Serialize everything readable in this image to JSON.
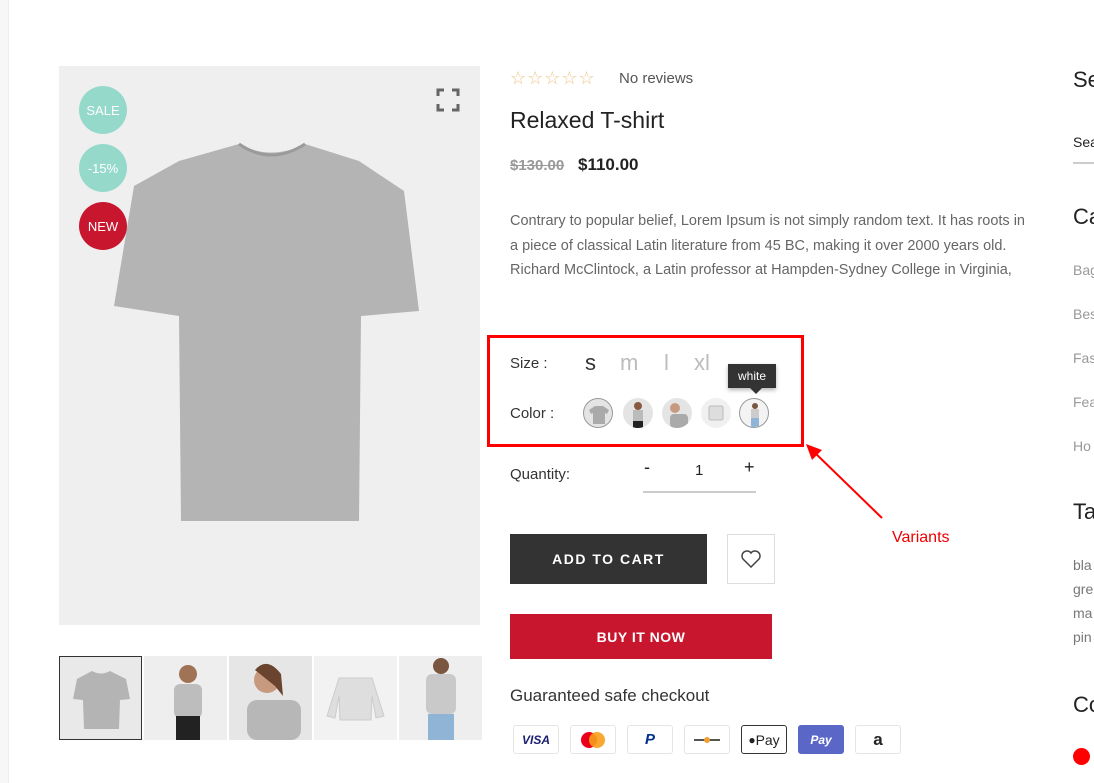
{
  "badges": {
    "sale": "SALE",
    "discount": "-15%",
    "new": "NEW"
  },
  "colors": {
    "sale": "#95d9cb",
    "new": "#c8162e",
    "accent": "#c8162e",
    "annotation": "#ff0000"
  },
  "rating": {
    "stars": "☆☆☆☆☆",
    "text": "No reviews"
  },
  "product": {
    "title": "Relaxed T-shirt",
    "old_price": "$130.00",
    "price": "$110.00",
    "description": "Contrary to popular belief, Lorem Ipsum is not simply random text. It has roots in a piece of classical Latin literature from 45 BC, making it over 2000 years old. Richard McClintock, a Latin professor at Hampden-Sydney College in Virginia,"
  },
  "variants": {
    "size_label": "Size :",
    "sizes": [
      "s",
      "m",
      "l",
      "xl"
    ],
    "color_label": "Color :",
    "tooltip": "white"
  },
  "quantity": {
    "label": "Quantity:",
    "minus": "-",
    "value": "1",
    "plus": "+"
  },
  "buttons": {
    "add_to_cart": "ADD TO CART",
    "buy_now": "BUY IT NOW"
  },
  "checkout": {
    "title": "Guaranteed safe checkout",
    "methods": [
      "VISA",
      "",
      "P",
      "",
      "Pay",
      "Pay",
      "a"
    ]
  },
  "annotation": "Variants",
  "sidebar": {
    "search_title": "Se",
    "search_placeholder": "Sea",
    "categories_title": "Ca",
    "categories": [
      "Bag",
      "Bes",
      "Fas",
      "Fea",
      "Ho"
    ],
    "tags_title": "Ta",
    "tags": [
      "bla",
      "gre",
      "ma",
      "pin"
    ],
    "colors_title": "Co"
  }
}
